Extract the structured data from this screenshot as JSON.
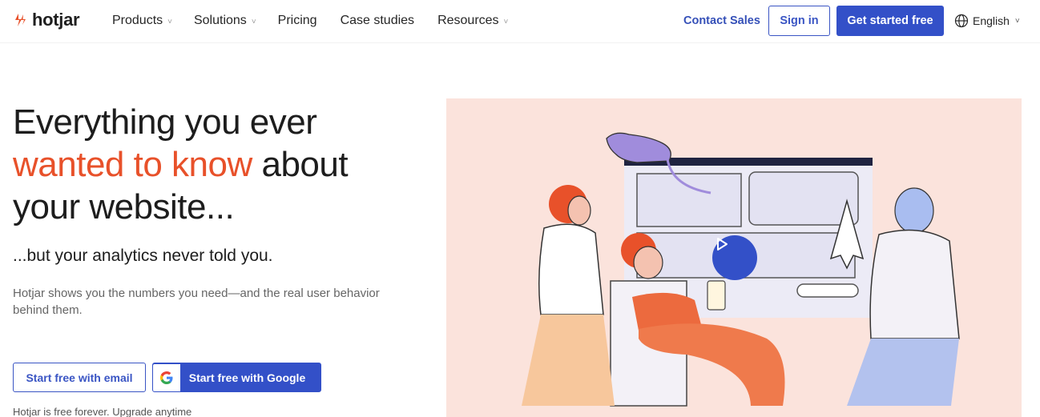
{
  "brand": {
    "name": "hotjar",
    "accent": "#e8512a",
    "primary": "#3350c8"
  },
  "nav": {
    "items": [
      {
        "label": "Products",
        "has_dropdown": true
      },
      {
        "label": "Solutions",
        "has_dropdown": true
      },
      {
        "label": "Pricing",
        "has_dropdown": false
      },
      {
        "label": "Case studies",
        "has_dropdown": false
      },
      {
        "label": "Resources",
        "has_dropdown": true
      }
    ],
    "contact_sales": "Contact Sales",
    "sign_in": "Sign in",
    "get_started": "Get started free",
    "language": "English",
    "dropdown_glyph": "˅"
  },
  "hero": {
    "headline_part1": "Everything you ever",
    "headline_accent": "wanted to know",
    "headline_part2": "about",
    "headline_part3": "your website...",
    "subheadline": "...but your analytics never told you.",
    "description": "Hotjar shows you the numbers you need—and the real user behavior behind them.",
    "cta_email": "Start free with email",
    "cta_google": "Start free with Google",
    "footnote": "Hotjar is free forever. Upgrade anytime"
  },
  "illustration": {
    "background": "#fbe3dc",
    "play_icon": "play-icon"
  }
}
